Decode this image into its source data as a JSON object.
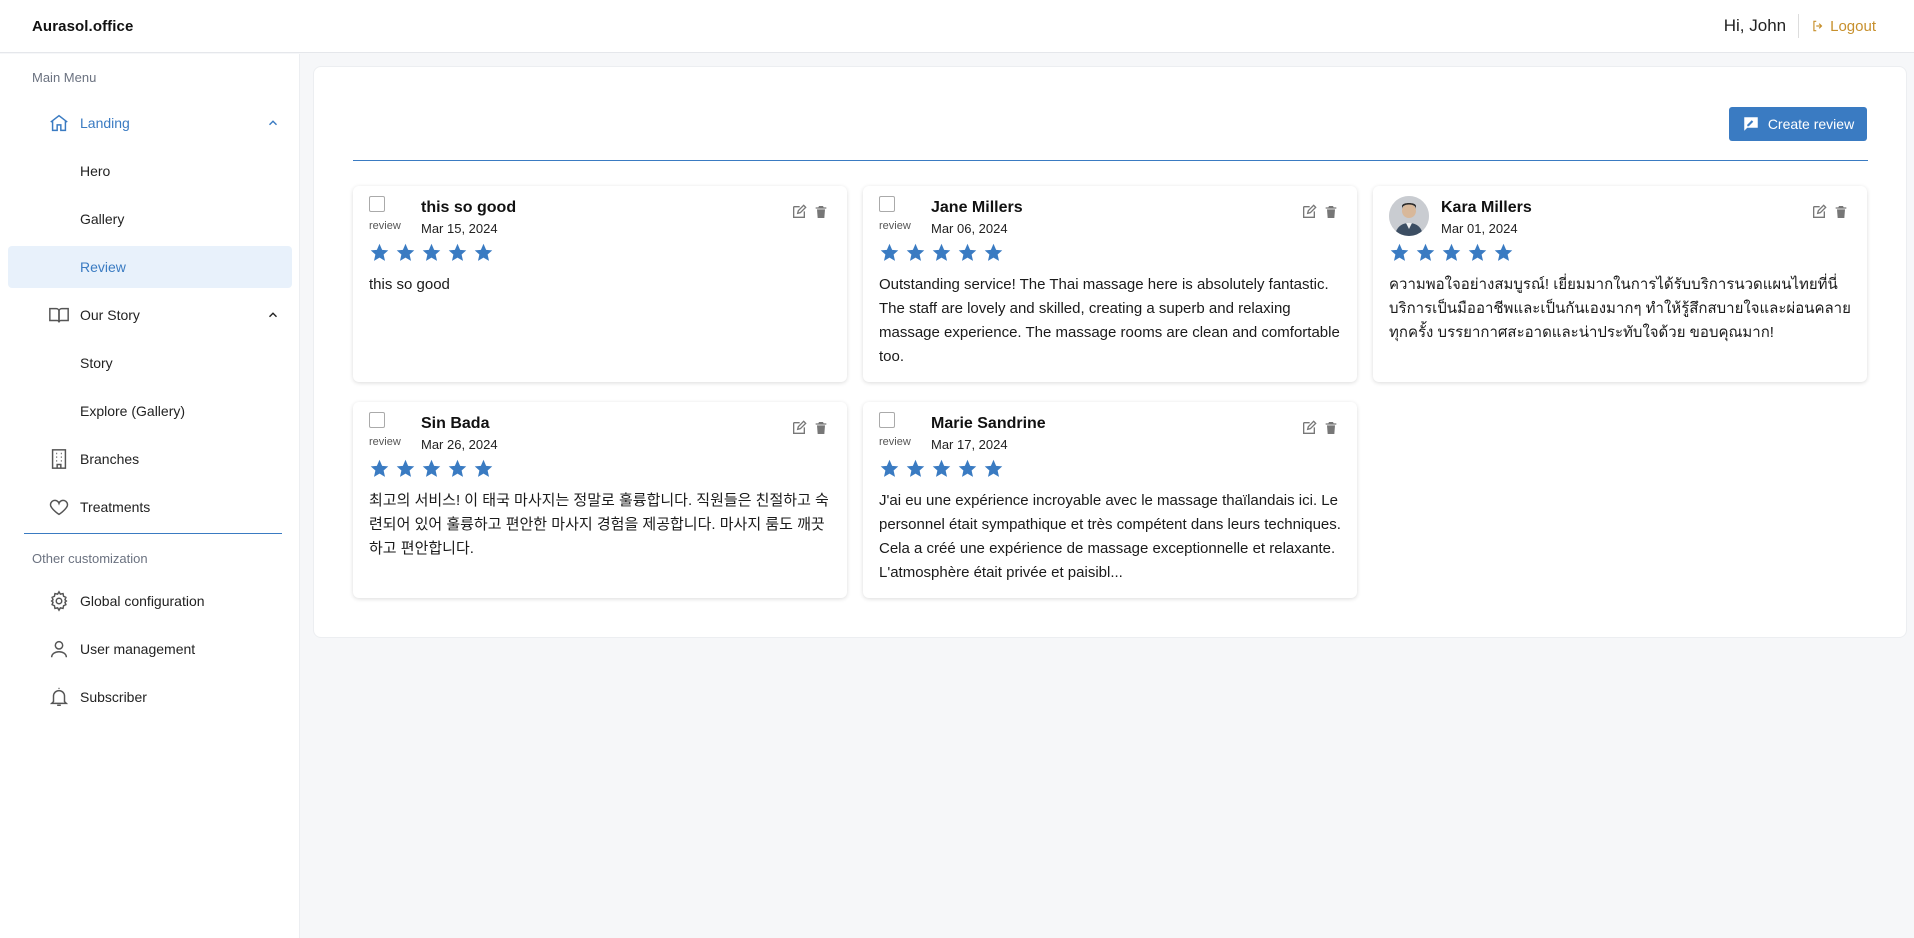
{
  "app": {
    "brand": "Aurasol.office",
    "greeting": "Hi, John",
    "logout_label": "Logout"
  },
  "sidebar": {
    "main_menu_title": "Main Menu",
    "landing": "Landing",
    "hero": "Hero",
    "gallery": "Gallery",
    "review": "Review",
    "our_story": "Our Story",
    "story": "Story",
    "explore_gallery": "Explore (Gallery)",
    "branches": "Branches",
    "treatments": "Treatments",
    "other_title": "Other customization",
    "global_configuration": "Global configuration",
    "user_management": "User management",
    "subscriber": "Subscriber"
  },
  "toolbar": {
    "create_review_label": "Create review"
  },
  "colors": {
    "accent": "#3a7bc2",
    "logout": "#c7902d"
  },
  "reviews": [
    {
      "avatar_alt": "review",
      "name": "this so good",
      "date": "Mar 15, 2024",
      "rating": 5,
      "text": "this so good"
    },
    {
      "avatar_alt": "review",
      "name": "Jane Millers",
      "date": "Mar 06, 2024",
      "rating": 5,
      "text": "Outstanding service! The Thai massage here is absolutely fantastic. The staff are lovely and skilled, creating a superb and relaxing massage experience. The massage rooms are clean and comfortable too."
    },
    {
      "avatar_alt": "",
      "name": "Kara Millers",
      "date": "Mar 01, 2024",
      "rating": 5,
      "text": "ความพอใจอย่างสมบูรณ์! เยี่ยมมากในการได้รับบริการนวดแผนไทยที่นี่ บริการเป็นมืออาชีพและเป็นกันเองมากๆ ทำให้รู้สึกสบายใจและผ่อนคลายทุกครั้ง บรรยากาศสะอาดและน่าประทับใจด้วย ขอบคุณมาก!"
    },
    {
      "avatar_alt": "review",
      "name": "Sin Bada",
      "date": "Mar 26, 2024",
      "rating": 5,
      "text": "최고의 서비스! 이 태국 마사지는 정말로 훌륭합니다. 직원들은 친절하고 숙련되어 있어 훌륭하고 편안한 마사지 경험을 제공합니다. 마사지 룸도 깨끗하고 편안합니다."
    },
    {
      "avatar_alt": "review",
      "name": "Marie Sandrine",
      "date": "Mar 17, 2024",
      "rating": 5,
      "text": "J'ai eu une expérience incroyable avec le massage thaïlandais ici. Le personnel était sympathique et très compétent dans leurs techniques. Cela a créé une expérience de massage exceptionnelle et relaxante. L'atmosphère était privée et paisibl..."
    }
  ]
}
